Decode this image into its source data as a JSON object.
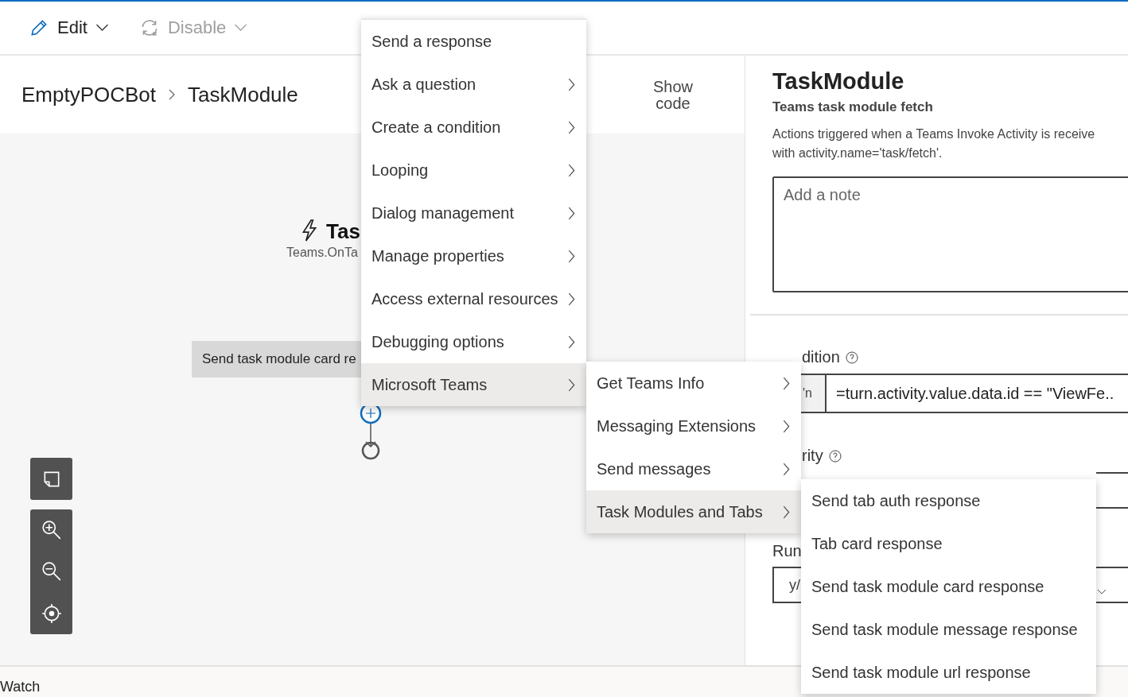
{
  "toolbar": {
    "buttons": [
      {
        "label": "Edit",
        "kind": "edit",
        "disabled": false
      },
      {
        "label": "Disable",
        "kind": "disable",
        "disabled": true
      }
    ]
  },
  "breadcrumb": [
    "EmptyPOCBot",
    "TaskModule"
  ],
  "show_code": "Show code",
  "canvas": {
    "trigger": {
      "title": "Tas",
      "subtitle": "Teams.OnTa"
    },
    "action": "Send task module card re"
  },
  "properties": {
    "title": "TaskModule",
    "subtitle": "Teams task module fetch",
    "description_lines": [
      "Actions triggered when a Teams Invoke Activity is receive",
      "with activity.name='task/fetch'."
    ],
    "note": {
      "placeholder": "Add a note"
    },
    "condition": {
      "label": "dition",
      "prefix": "'n",
      "value": "=turn.activity.value.data.id == \"ViewFe.."
    },
    "priority": {
      "label": "rity"
    },
    "run": {
      "label": "Run",
      "value": "y/"
    }
  },
  "bottom_panel": {
    "tab": "Watch"
  },
  "menus": [
    {
      "items": [
        {
          "label": "Send a response",
          "submenu": false,
          "selected": false
        },
        {
          "label": "Ask a question",
          "submenu": true,
          "selected": false
        },
        {
          "label": "Create a condition",
          "submenu": true,
          "selected": false
        },
        {
          "label": "Looping",
          "submenu": true,
          "selected": false
        },
        {
          "label": "Dialog management",
          "submenu": true,
          "selected": false
        },
        {
          "label": "Manage properties",
          "submenu": true,
          "selected": false
        },
        {
          "label": "Access external resources",
          "submenu": true,
          "selected": false
        },
        {
          "label": "Debugging options",
          "submenu": true,
          "selected": false
        },
        {
          "label": "Microsoft Teams",
          "submenu": true,
          "selected": true
        }
      ]
    },
    {
      "items": [
        {
          "label": "Get Teams Info",
          "submenu": true,
          "selected": false
        },
        {
          "label": "Messaging Extensions",
          "submenu": true,
          "selected": false
        },
        {
          "label": "Send messages",
          "submenu": true,
          "selected": false
        },
        {
          "label": "Task Modules and Tabs",
          "submenu": true,
          "selected": true
        }
      ]
    },
    {
      "items": [
        {
          "label": "Send tab auth response",
          "submenu": false,
          "selected": false
        },
        {
          "label": "Tab card response",
          "submenu": false,
          "selected": false
        },
        {
          "label": "Send task module card response",
          "submenu": false,
          "selected": false
        },
        {
          "label": "Send task module message response",
          "submenu": false,
          "selected": false
        },
        {
          "label": "Send task module url response",
          "submenu": false,
          "selected": false
        }
      ]
    }
  ]
}
